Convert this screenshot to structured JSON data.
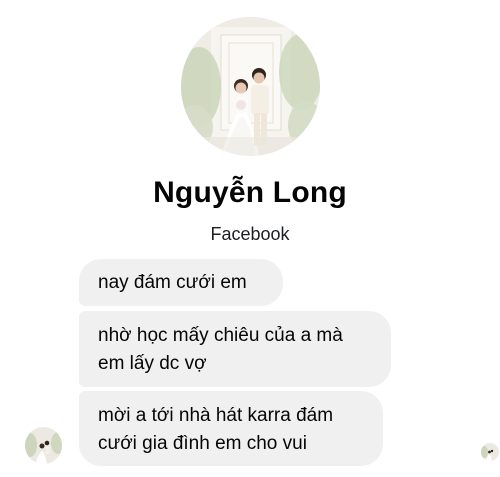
{
  "profile": {
    "name": "Nguyễn Long",
    "subtitle": "Facebook",
    "photo_icon": "wedding-photo"
  },
  "messages": [
    {
      "lines": [
        "nay đám cưới em"
      ]
    },
    {
      "lines": [
        "nhờ học mấy chiêu của a mà",
        "em lấy dc vợ"
      ]
    },
    {
      "lines": [
        "mời a tới nhà hát karra đám",
        "cưới gia đình em cho vui"
      ]
    }
  ],
  "colors": {
    "bubble_bg": "#f0f0f0",
    "text": "#050505",
    "background": "#ffffff"
  }
}
